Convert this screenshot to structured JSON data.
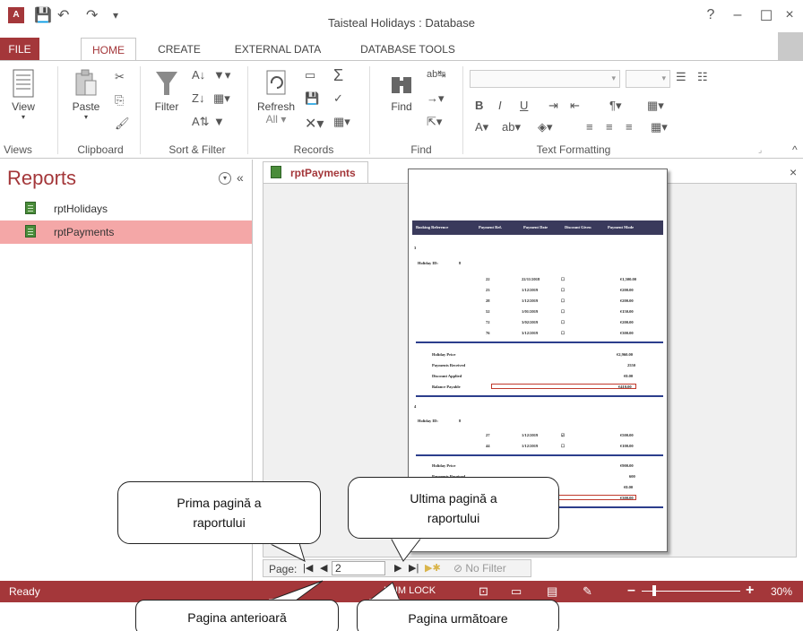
{
  "window": {
    "title": "Taisteal Holidays : Database",
    "app_badge": "A",
    "help": "?",
    "minimize": "–",
    "maximize": "☐",
    "close": "×"
  },
  "tabs": [
    "FILE",
    "HOME",
    "CREATE",
    "EXTERNAL DATA",
    "DATABASE TOOLS"
  ],
  "ribbon": {
    "views": {
      "label": "Views",
      "view_btn": "View"
    },
    "clipboard": {
      "label": "Clipboard",
      "paste_btn": "Paste"
    },
    "sort_filter": {
      "label": "Sort & Filter",
      "filter_btn": "Filter"
    },
    "records": {
      "label": "Records",
      "refresh_btn": "Refresh",
      "refresh_sub": "All"
    },
    "find": {
      "label": "Find",
      "find_btn": "Find"
    },
    "text_formatting": {
      "label": "Text Formatting",
      "bold": "B",
      "italic": "I",
      "underline": "U"
    }
  },
  "nav_pane": {
    "title": "Reports",
    "collapse": "«",
    "items": [
      {
        "label": "rptHolidays",
        "selected": false
      },
      {
        "label": "rptPayments",
        "selected": true
      }
    ]
  },
  "document": {
    "tab_label": "rptPayments",
    "close": "×"
  },
  "report": {
    "headers": [
      "Booking Reference",
      "Payment Ref.",
      "Payment Date",
      "Discount Given",
      "Payment Mode"
    ],
    "groups": [
      {
        "booking": "3",
        "holiday_label": "Holiday ID:",
        "holiday_id": "8",
        "payments": [
          {
            "ref": "22",
            "date": "22/11/2018",
            "disc": "☐",
            "amt": "€1,500.00"
          },
          {
            "ref": "23",
            "date": "1/12/2019",
            "disc": "☐",
            "amt": "€200.00"
          },
          {
            "ref": "28",
            "date": "1/12/2019",
            "disc": "☐",
            "amt": "€200.00"
          },
          {
            "ref": "52",
            "date": "1/01/2019",
            "disc": "☐",
            "amt": "€150.00"
          },
          {
            "ref": "72",
            "date": "3/02/2019",
            "disc": "☐",
            "amt": "€200.00"
          },
          {
            "ref": "76",
            "date": "3/12/2019",
            "disc": "☐",
            "amt": "€300.00"
          }
        ],
        "summary": [
          {
            "label": "Holiday Price",
            "value": "€2,960.00"
          },
          {
            "label": "Payments Received",
            "value": "2550"
          },
          {
            "label": "Discount Applied",
            "value": "€0.00"
          },
          {
            "label": "Balance Payable",
            "value": "€410.00"
          }
        ]
      },
      {
        "booking": "4",
        "holiday_label": "Holiday ID:",
        "holiday_id": "8",
        "payments": [
          {
            "ref": "27",
            "date": "1/12/2019",
            "disc": "☑",
            "amt": "€500.00"
          },
          {
            "ref": "44",
            "date": "1/12/2019",
            "disc": "☐",
            "amt": "€100.00"
          }
        ],
        "summary": [
          {
            "label": "Holiday Price",
            "value": "€900.00"
          },
          {
            "label": "Payments Received",
            "value": "600"
          },
          {
            "label": "Discount Applied",
            "value": "€0.00"
          },
          {
            "label": "Balance Payable",
            "value": "€300.00"
          }
        ]
      }
    ]
  },
  "nav_bar": {
    "page_label": "Page:",
    "page_value": "2",
    "no_filter": "No Filter"
  },
  "status": {
    "text": "Ready",
    "numlock": "NUM LOCK",
    "zoom": "30%",
    "zoom_minus": "–",
    "zoom_plus": "+"
  },
  "callouts": {
    "first_page": "Prima pagină a raportului",
    "last_page": "Ultima pagină a raportului",
    "previous_page": "Pagina anterioară",
    "next_page": "Pagina următoare"
  }
}
